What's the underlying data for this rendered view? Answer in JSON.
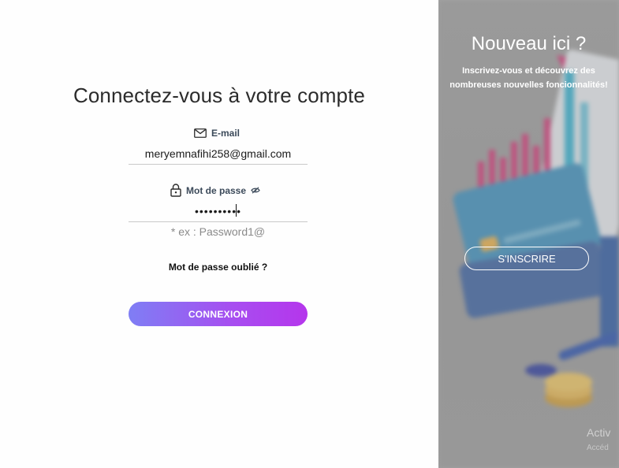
{
  "login": {
    "title": "Connectez-vous à votre compte",
    "email_label": "E-mail",
    "email_value": "meryemnafihi258@gmail.com",
    "password_label": "Mot de passe",
    "password_value": "••••••••••",
    "password_hint": "* ex : Password1@",
    "forgot_label": "Mot de passe oublié ?",
    "submit_label": "CONNEXION",
    "icons": {
      "email": "envelope-icon",
      "password": "lock-icon",
      "visibility": "eye-slash-icon"
    }
  },
  "signup_panel": {
    "title": "Nouveau ici ?",
    "subtitle": "Inscrivez-vous et découvrez des nombreuses nouvelles foncionnalités!",
    "button_label": "S'INSCRIRE"
  },
  "watermark": {
    "line1": "Activ",
    "line2": "Accéd"
  },
  "colors": {
    "button_gradient_start": "#7f7ef4",
    "button_gradient_end": "#b536ec",
    "panel_gray": "#a0a0a0"
  }
}
